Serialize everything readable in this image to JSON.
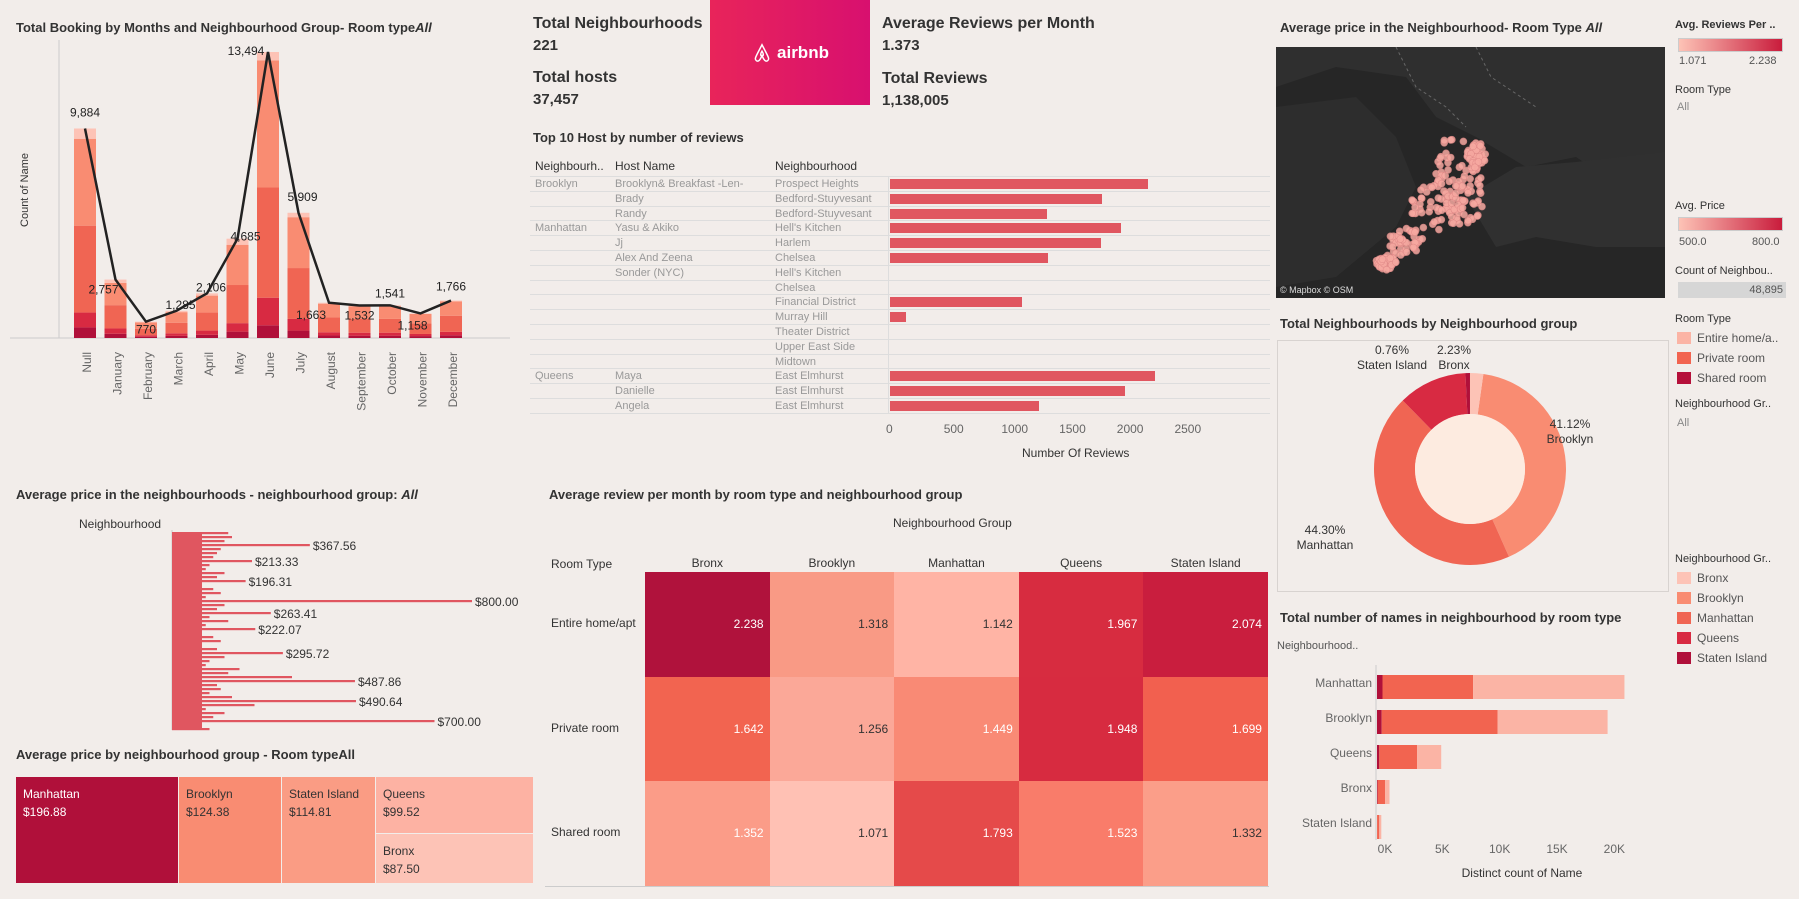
{
  "kpis": {
    "neighbourhoods_label": "Total Neighbourhoods",
    "neighbourhoods_value": "221",
    "hosts_label": "Total hosts",
    "hosts_value": "37,457",
    "reviews_pm_label": "Average Reviews per Month",
    "reviews_pm_value": "1.373",
    "total_reviews_label": "Total Reviews",
    "total_reviews_value": "1,138,005",
    "logo_text": "airbnb"
  },
  "bookings_chart": {
    "title_prefix": "Total Booking by Months and Neighbourhood Group- Room type",
    "title_suffix": "All",
    "ylabel": "Count of Name"
  },
  "hosts_chart": {
    "title": "Top 10 Host by number of reviews",
    "col_group": "Neighbourh..",
    "col_host": "Host Name",
    "col_neigh": "Neighbourhood",
    "xlabel": "Number Of Reviews"
  },
  "map": {
    "title_prefix": "Average price in the Neighbourhood- Room Type ",
    "title_suffix": "All",
    "attribution": "© Mapbox © OSM"
  },
  "filters": {
    "avg_reviews_label": "Avg. Reviews Per ..",
    "avg_reviews_min": "1.071",
    "avg_reviews_max": "2.238",
    "room_type_label": "Room Type",
    "room_type_value": "All",
    "avg_price_label": "Avg. Price",
    "avg_price_min": "500.0",
    "avg_price_max": "800.0",
    "count_label": "Count of Neighbou..",
    "count_value": "48,895",
    "room_legend_title": "Room Type",
    "room_legend": [
      "Entire home/a..",
      "Private room",
      "Shared room"
    ],
    "room_legend_colors": [
      "#fbb4a5",
      "#f26450",
      "#b5103a"
    ],
    "ng_filter_label": "Neighbourhood Gr..",
    "ng_filter_value": "All",
    "ng_legend_title": "Neighbourhood Gr..",
    "ng_legend": [
      "Bronx",
      "Brooklyn",
      "Manhattan",
      "Queens",
      "Staten Island"
    ],
    "ng_legend_colors": [
      "#fdc3b6",
      "#f98c72",
      "#f06553",
      "#d82a42",
      "#b0103a"
    ]
  },
  "donut": {
    "title": "Total Neighbourhoods by Neighbourhood  group",
    "labels": [
      {
        "pct": "41.12%",
        "name": "Brooklyn"
      },
      {
        "pct": "44.30%",
        "name": "Manhattan"
      },
      {
        "pct": "0.76%",
        "name": "Staten Island"
      },
      {
        "pct": "2.23%",
        "name": "Bronx"
      }
    ]
  },
  "price_neigh": {
    "title_prefix": "Average price in the neighbourhoods - neighbourhood group: ",
    "title_suffix": "All",
    "col": "Neighbourhood",
    "labels": [
      "$367.56",
      "$213.33",
      "$196.31",
      "$800.00",
      "$263.41",
      "$222.07",
      "$295.72",
      "$487.86",
      "$490.64",
      "$700.00"
    ]
  },
  "treemap": {
    "title": "Average price by neighbourhood group - Room typeAll",
    "cells": [
      {
        "name": "Manhattan",
        "value": "$196.88"
      },
      {
        "name": "Brooklyn",
        "value": "$124.38"
      },
      {
        "name": "Staten Island",
        "value": "$114.81"
      },
      {
        "name": "Queens",
        "value": "$99.52"
      },
      {
        "name": "Bronx",
        "value": "$87.50"
      }
    ]
  },
  "heatmap": {
    "title": "Average review per month by room type and neighbourhood group",
    "col_header": "Neighbourhood Group",
    "row_header": "Room Type"
  },
  "names_chart": {
    "title": "Total number of names in neighbourhood by room type",
    "col": "Neighbourhood..",
    "xlabel": "Distinct count of Name"
  },
  "chart_data": [
    {
      "id": "bookings",
      "type": "bar",
      "title": "Total Booking by Months and Neighbourhood Group- Room typeAll",
      "ylabel": "Count of Name",
      "categories": [
        "Null",
        "January",
        "February",
        "March",
        "April",
        "May",
        "June",
        "July",
        "August",
        "September",
        "October",
        "November",
        "December"
      ],
      "totals": [
        9884,
        2757,
        770,
        1285,
        2106,
        4685,
        13494,
        5909,
        1663,
        1532,
        1541,
        1158,
        1766
      ],
      "total_labels": [
        "9,884",
        "2,757",
        "770",
        "1,285",
        "2,106",
        "4,685",
        "13,494",
        "5,909",
        "1,663",
        "1,532",
        "1,541",
        "1,158",
        "1,766"
      ],
      "series": [
        {
          "name": "Staten Island",
          "values": [
            500,
            200,
            60,
            100,
            150,
            300,
            600,
            350,
            120,
            110,
            110,
            90,
            130
          ]
        },
        {
          "name": "Queens",
          "values": [
            700,
            250,
            70,
            120,
            200,
            400,
            1300,
            550,
            150,
            140,
            140,
            100,
            160
          ]
        },
        {
          "name": "Manhattan",
          "values": [
            4100,
            1100,
            300,
            500,
            850,
            1800,
            5200,
            2400,
            700,
            650,
            650,
            500,
            760
          ]
        },
        {
          "name": "Brooklyn",
          "values": [
            4100,
            1050,
            300,
            500,
            800,
            1900,
            6000,
            2400,
            650,
            600,
            600,
            450,
            680
          ]
        },
        {
          "name": "Bronx",
          "values": [
            484,
            157,
            40,
            65,
            106,
            285,
            394,
            209,
            43,
            32,
            41,
            18,
            36
          ]
        }
      ],
      "colors": [
        "#b0103a",
        "#d82a42",
        "#f06553",
        "#f98c72",
        "#fdc3b6"
      ]
    },
    {
      "id": "top_hosts",
      "type": "bar",
      "title": "Top 10 Host by number of reviews",
      "xlabel": "Number Of Reviews",
      "xlim": [
        0,
        2600
      ],
      "xticks": [
        0,
        500,
        1000,
        1500,
        2000,
        2500
      ],
      "rows": [
        {
          "group": "Brooklyn",
          "host": "Brooklyn&  Breakfast   -Len-",
          "neigh": "Prospect Heights",
          "value": 2240
        },
        {
          "group": "",
          "host": "Brady",
          "neigh": "Bedford-Stuyvesant",
          "value": 1840
        },
        {
          "group": "",
          "host": "Randy",
          "neigh": "Bedford-Stuyvesant",
          "value": 1360
        },
        {
          "group": "Manhattan",
          "host": "Yasu & Akiko",
          "neigh": "Hell's Kitchen",
          "value": 2000
        },
        {
          "group": "",
          "host": "Jj",
          "neigh": "Harlem",
          "value": 1830
        },
        {
          "group": "",
          "host": "Alex And Zeena",
          "neigh": "Chelsea",
          "value": 1370
        },
        {
          "group": "",
          "host": "Sonder (NYC)",
          "neigh": "Hell's Kitchen",
          "value": 0
        },
        {
          "group": "",
          "host": "",
          "neigh": "Chelsea",
          "value": 0
        },
        {
          "group": "",
          "host": "",
          "neigh": "Financial District",
          "value": 1140
        },
        {
          "group": "",
          "host": "",
          "neigh": "Murray Hill",
          "value": 140
        },
        {
          "group": "",
          "host": "",
          "neigh": "Theater District",
          "value": 0
        },
        {
          "group": "",
          "host": "",
          "neigh": "Upper East Side",
          "value": 0
        },
        {
          "group": "",
          "host": "",
          "neigh": "Midtown",
          "value": 0
        },
        {
          "group": "Queens",
          "host": "Maya",
          "neigh": "East Elmhurst",
          "value": 2300
        },
        {
          "group": "",
          "host": "Danielle",
          "neigh": "East Elmhurst",
          "value": 2040
        },
        {
          "group": "",
          "host": "Angela",
          "neigh": "East Elmhurst",
          "value": 1290
        }
      ]
    },
    {
      "id": "donut",
      "type": "pie",
      "title": "Total Neighbourhoods by Neighbourhood  group",
      "slices": [
        {
          "name": "Brooklyn",
          "value": 41.12,
          "color": "#f98c72"
        },
        {
          "name": "Manhattan",
          "value": 44.3,
          "color": "#f06553"
        },
        {
          "name": "Queens",
          "value": 11.59,
          "color": "#d82a42"
        },
        {
          "name": "Staten Island",
          "value": 0.76,
          "color": "#b0103a"
        },
        {
          "name": "Bronx",
          "value": 2.23,
          "color": "#fdc3b6"
        }
      ]
    },
    {
      "id": "price_neigh",
      "type": "bar",
      "title": "Average price in the neighbourhoods - neighbourhood group: All",
      "xlim": [
        0,
        800
      ],
      "values": [
        150,
        160,
        140,
        367.56,
        130,
        120,
        110,
        213.33,
        100,
        90,
        140,
        120,
        196.31,
        80,
        110,
        130,
        90,
        800.0,
        140,
        120,
        263.41,
        100,
        150,
        90,
        222.07,
        80,
        110,
        130,
        70,
        120,
        295.72,
        140,
        100,
        90,
        180,
        150,
        320,
        487.86,
        120,
        130,
        100,
        160,
        490.64,
        220,
        90,
        140,
        110,
        700.0,
        80,
        100
      ],
      "labels": [
        "$367.56",
        "$213.33",
        "$196.31",
        "$800.00",
        "$263.41",
        "$222.07",
        "$295.72",
        "$487.86",
        "$490.64",
        "$700.00"
      ]
    },
    {
      "id": "treemap",
      "type": "bar",
      "title": "Average price by neighbourhood group - Room typeAll",
      "categories": [
        "Manhattan",
        "Brooklyn",
        "Staten Island",
        "Queens",
        "Bronx"
      ],
      "values": [
        196.88,
        124.38,
        114.81,
        99.52,
        87.5
      ]
    },
    {
      "id": "heatmap",
      "type": "heatmap",
      "title": "Average review per month by room type and neighbourhood group",
      "columns": [
        "Bronx",
        "Brooklyn",
        "Manhattan",
        "Queens",
        "Staten Island"
      ],
      "rows": [
        "Entire home/apt",
        "Private room",
        "Shared room"
      ],
      "values": [
        [
          2.238,
          1.318,
          1.142,
          1.967,
          2.074
        ],
        [
          1.642,
          1.256,
          1.449,
          1.948,
          1.699
        ],
        [
          1.352,
          1.071,
          1.793,
          1.523,
          1.332
        ]
      ],
      "value_labels": [
        [
          "2.238",
          "1.318",
          "1.142",
          "1.967",
          "2.074"
        ],
        [
          "1.642",
          "1.256",
          "1.449",
          "1.948",
          "1.699"
        ],
        [
          "1.352",
          "1.071",
          "1.793",
          "1.523",
          "1.332"
        ]
      ],
      "colors": [
        [
          "#b0123c",
          "#f99a85",
          "#ffb4a5",
          "#d72c40",
          "#c91e3e"
        ],
        [
          "#f26450",
          "#fba898",
          "#f98a75",
          "#d72b40",
          "#f2604f"
        ],
        [
          "#fb9c88",
          "#ffc1b4",
          "#e54a4a",
          "#f97c6a",
          "#fb9e89"
        ]
      ]
    },
    {
      "id": "names",
      "type": "bar",
      "title": "Total number of names in neighbourhood by room type",
      "xlabel": "Distinct count of Name",
      "xlim": [
        0,
        22500
      ],
      "xticks": [
        "0K",
        "5K",
        "10K",
        "15K",
        "20K"
      ],
      "categories": [
        "Manhattan",
        "Brooklyn",
        "Queens",
        "Bronx",
        "Staten Island"
      ],
      "series": [
        {
          "name": "Shared room",
          "values": [
            480,
            410,
            200,
            60,
            10
          ]
        },
        {
          "name": "Private room",
          "values": [
            7900,
            10100,
            3300,
            650,
            190
          ]
        },
        {
          "name": "Entire home/apt",
          "values": [
            13200,
            9600,
            2100,
            380,
            175
          ]
        }
      ],
      "colors": [
        "#b0103a",
        "#f26450",
        "#fbb4a5"
      ]
    }
  ]
}
